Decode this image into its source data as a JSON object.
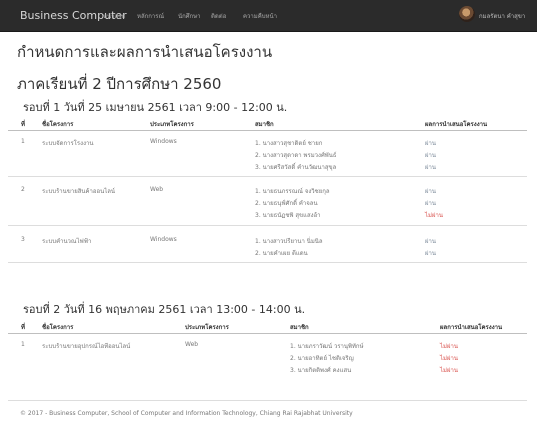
{
  "nav": {
    "brand": "Business Computer",
    "links": [
      "หน้าแรก",
      "หลักการณ์",
      "นักศึกษา",
      "ติดต่อ",
      "ความคืบหน้า"
    ],
    "user_name": "กมลรัตนา คำสุขา"
  },
  "page": {
    "title": "กำหนดการและผลการนำเสนอโครงงาน",
    "semester": "ภาคเรียนที่ 2 ปีการศึกษา 2560"
  },
  "table_headers": [
    "ที่",
    "ชื่อโครงการ",
    "ประเภทโครงการ",
    "สมาชิก",
    "ผลการนำเสนอโครงงาน"
  ],
  "rounds": [
    {
      "heading": "รอบที่ 1 วันที่ 25 เมษายน 2561 เวลา 9:00 - 12:00 น.",
      "projects": [
        {
          "no": "1",
          "name": "ระบบจัดการโรงงาน",
          "type": "Windows",
          "members": [
            {
              "name": "1. นางสาวสุชาดิตย์ ชายก",
              "result": "ผ่าน",
              "pass": true
            },
            {
              "name": "2. นางสาวสุดาดา พรมวงศ์พันธ์",
              "result": "ผ่าน",
              "pass": true
            },
            {
              "name": "3. นายศรีสวัสดิ์ คำนวัฒนาสุขุล",
              "result": "ผ่าน",
              "pass": true
            }
          ]
        },
        {
          "no": "2",
          "name": "ระบบร้านขายสินค้าออนไลน์",
          "type": "Web",
          "members": [
            {
              "name": "1. นายธนภรรณณ์ จงวิชยกุล",
              "result": "ผ่าน",
              "pass": true
            },
            {
              "name": "2. นายธนุฟ์ศักดิ์ คำจลน",
              "result": "ผ่าน",
              "pass": true
            },
            {
              "name": "3. นายธนัฏชพิ สุขแสงอ้า",
              "result": "ไม่ผ่าน",
              "pass": false
            }
          ]
        },
        {
          "no": "3",
          "name": "ระบบคำนวณไฟฟ้า",
          "type": "Windows",
          "members": [
            {
              "name": "1. นางสาวปรียานา นิ่มนิล",
              "result": "ผ่าน",
              "pass": true
            },
            {
              "name": "2. นายคำเผย ดีแดน",
              "result": "ผ่าน",
              "pass": true
            }
          ]
        }
      ]
    },
    {
      "heading": "รอบที่ 2 วันที่ 16 พฤษภาคม 2561 เวลา 13:00 - 14:00 น.",
      "projects": [
        {
          "no": "1",
          "name": "ระบบร้านขายอุปกรณ์ไอทีออนไลน์",
          "type": "Web",
          "members": [
            {
              "name": "1. นายภราวัฒน์ วรานุพิทักษ์",
              "result": "ไม่ผ่าน",
              "pass": false
            },
            {
              "name": "2. นายอาทิตย์ ไชติเจริญ",
              "result": "ไม่ผ่าน",
              "pass": false
            },
            {
              "name": "3. นายกิตติพงศ์ คงแสน",
              "result": "ไม่ผ่าน",
              "pass": false
            }
          ]
        }
      ]
    }
  ],
  "footer": "© 2017 - Business Computer, School of Computer and Information Technology, Chiang Rai Rajabhat University",
  "colors": {
    "navbar": "#2b2b2b",
    "pass": "#7c8a9a",
    "fail": "#d9534f"
  }
}
